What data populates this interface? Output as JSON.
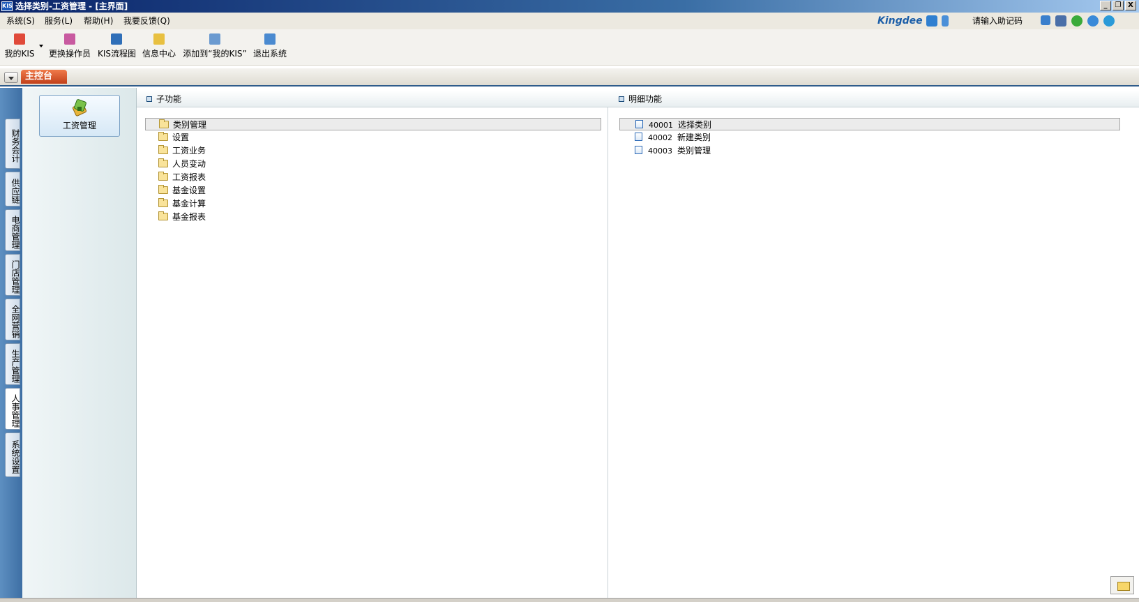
{
  "window": {
    "title": "选择类别-工资管理 - [主界面]",
    "app_badge": "KIS",
    "buttons": [
      "_",
      "❐",
      "X"
    ]
  },
  "menu": {
    "items": [
      "系统(S)",
      "服务(L)",
      "帮助(H)",
      "我要反馈(Q)"
    ],
    "brand": "Kingdee",
    "helper_label": "请输入助记码",
    "helper_value": ""
  },
  "toolbar": {
    "items": [
      {
        "label": "我的KIS",
        "icon": "star-icon"
      },
      {
        "label": "更换操作员",
        "icon": "users-icon"
      },
      {
        "label": "KIS流程图",
        "icon": "flowchart-icon"
      },
      {
        "label": "信息中心",
        "icon": "message-icon"
      },
      {
        "label": "添加到“我的KIS”",
        "icon": "add-favorite-icon"
      },
      {
        "label": "退出系统",
        "icon": "exit-icon"
      }
    ]
  },
  "tabstrip": {
    "main_tab": "主控台"
  },
  "left_categories": [
    "财务会计",
    "供应链",
    "电商管理",
    "门店管理",
    "全网营销",
    "生产管理",
    "人事管理",
    "系统设置"
  ],
  "active_category": "人事管理",
  "module": {
    "label": "工资管理",
    "icon": "salary-icon"
  },
  "sub_function": {
    "title": "子功能",
    "items": [
      "类别管理",
      "设置",
      "工资业务",
      "人员变动",
      "工资报表",
      "基金设置",
      "基金计算",
      "基金报表"
    ],
    "selected": "类别管理"
  },
  "detail_function": {
    "title": "明细功能",
    "items": [
      {
        "code": "40001",
        "label": "选择类别"
      },
      {
        "code": "40002",
        "label": "新建类别"
      },
      {
        "code": "40003",
        "label": "类别管理"
      }
    ],
    "selected": "选择类别"
  },
  "colors": {
    "title_bar": "#0a246a",
    "accent_tab": "#d9532a",
    "left_strip": "#4a7db3"
  }
}
